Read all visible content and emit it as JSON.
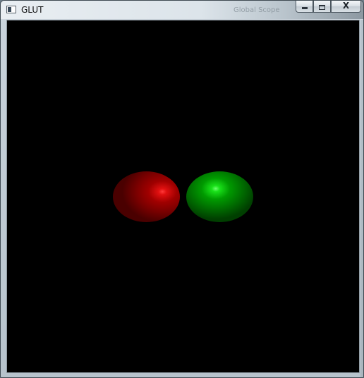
{
  "window": {
    "title": "GLUT",
    "background_title_text": "Global Scope",
    "controls": {
      "minimize_icon": "minimize-icon",
      "maximize_icon": "maximize-icon",
      "close_icon": "close-icon",
      "close_glyph": "X"
    }
  },
  "scene": {
    "background_color": "#000000",
    "spheres": [
      {
        "name": "red-sphere",
        "color": "#cc0000",
        "highlight": "#ff2020"
      },
      {
        "name": "green-sphere",
        "color": "#00aa00",
        "highlight": "#66ff66"
      }
    ]
  }
}
